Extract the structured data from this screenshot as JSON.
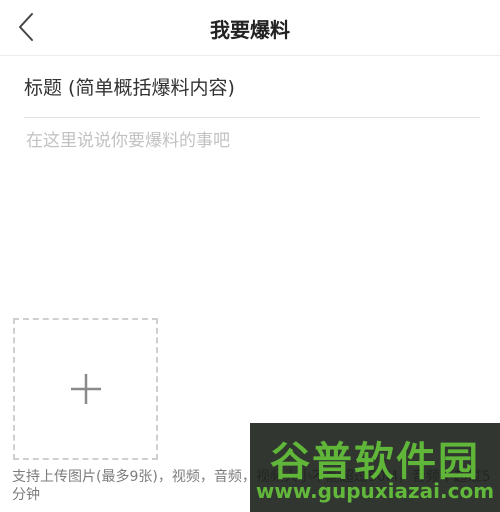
{
  "header": {
    "title": "我要爆料",
    "back_icon": "chevron-left-icon"
  },
  "form": {
    "title_placeholder": "标题 (简单概括爆料内容)",
    "content_placeholder": "在这里说说你要爆料的事吧"
  },
  "upload": {
    "icon": "plus-icon",
    "hint": "支持上传图片(最多9张)，视频，音频，视频大小不能超过50M，音频不超过5分钟"
  },
  "watermark": {
    "name": "谷普软件园",
    "url": "www.gupuxiazai.com"
  },
  "colors": {
    "placeholder": "#c2c2c2",
    "hint_text": "#7c7c7c",
    "watermark_green": "#5fb638"
  }
}
